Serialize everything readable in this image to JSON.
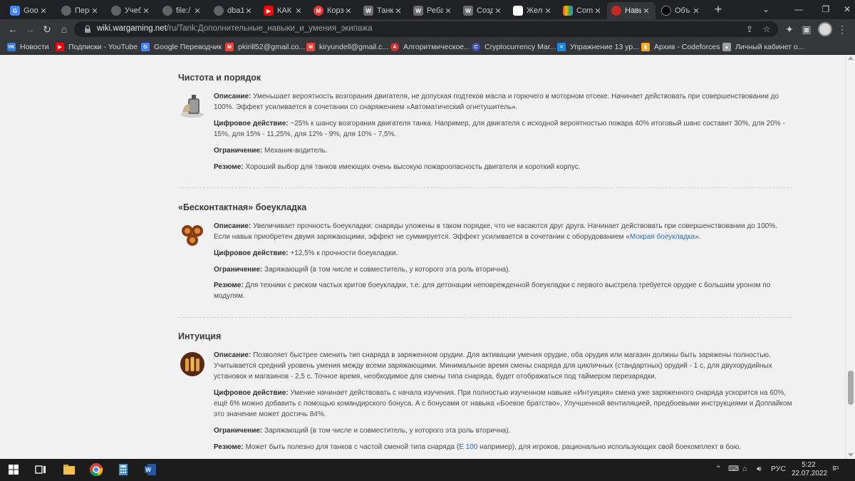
{
  "browser": {
    "tabs": [
      {
        "title": "Goog",
        "fav_color": "#4285f4",
        "fav_text": "G"
      },
      {
        "title": "Пере",
        "fav_color": "#5f6368",
        "fav_text": ""
      },
      {
        "title": "Учеб",
        "fav_color": "#5f6368",
        "fav_text": ""
      },
      {
        "title": "file:/",
        "fav_color": "#5f6368",
        "fav_text": ""
      },
      {
        "title": "dba1",
        "fav_color": "#5f6368",
        "fav_text": ""
      },
      {
        "title": "КАК",
        "fav_color": "#ff0000",
        "fav_text": "▶"
      },
      {
        "title": "Корз",
        "fav_color": "#e53935",
        "fav_text": "M"
      },
      {
        "title": "Танк",
        "fav_color": "#6d6d6d",
        "fav_text": "W"
      },
      {
        "title": "Реба",
        "fav_color": "#6d6d6d",
        "fav_text": "W"
      },
      {
        "title": "Созд",
        "fav_color": "#6d6d6d",
        "fav_text": "W"
      },
      {
        "title": "Желе",
        "fav_color": "#ffffff",
        "fav_text": ""
      },
      {
        "title": "Com",
        "fav_color": "#34a853",
        "fav_text": ""
      },
      {
        "title": "Навы",
        "fav_color": "#c62828",
        "fav_text": ""
      },
      {
        "title": "Объ",
        "fav_color": "#000000",
        "fav_text": ""
      }
    ],
    "active_tab_index": 12,
    "new_tab_label": "+",
    "url_host": "wiki.wargaming.net",
    "url_path": "/ru/Tank:Дополнительные_навыки_и_умения_экипажа",
    "bookmarks": [
      {
        "label": "Новости",
        "fav_color": "#2c7be5",
        "fav_text": "VK"
      },
      {
        "label": "Подписки - YouTube",
        "fav_color": "#ff0000",
        "fav_text": "▶"
      },
      {
        "label": "Google Переводчик",
        "fav_color": "#4285f4",
        "fav_text": "G"
      },
      {
        "label": "pkirill52@gmail.co...",
        "fav_color": "#ea4335",
        "fav_text": "M"
      },
      {
        "label": "kiryundell@gmail.c...",
        "fav_color": "#ea4335",
        "fav_text": "M"
      },
      {
        "label": "Алгоритмическое...",
        "fav_color": "#d32f2f",
        "fav_text": "A"
      },
      {
        "label": "Cryptocurrency Mar...",
        "fav_color": "#3f51b5",
        "fav_text": "C"
      },
      {
        "label": "Упражнение 13 ур...",
        "fav_color": "#1e88e5",
        "fav_text": "="
      },
      {
        "label": "Архив - Codeforces",
        "fav_color": "#f9a825",
        "fav_text": "▮"
      },
      {
        "label": "Личный кабинет о...",
        "fav_color": "#9e9e9e",
        "fav_text": "▲"
      }
    ]
  },
  "sections": [
    {
      "title": "Чистота и порядок",
      "desc_label": "Описание:",
      "desc": "Уменьшает вероятность возгорания двигателя, не допуская подтеков масла и горючего в моторном отсеке. Начинает действовать при совершенствовании до 100%. Эффект усиливается в сочетании со снаряжением «Автоматический огнетушитель».",
      "effect_label": "Цифровое действие:",
      "effect": "−25% к шансу возгорания двигателя танка. Например, для двигателя с исходной вероятностью пожара 40% итоговый шанс составит 30%, для 20% - 15%, для 15% - 11,25%, для 12% - 9%, для 10% - 7,5%.",
      "limit_label": "Ограничение:",
      "limit": "Механик-водитель.",
      "summary_label": "Резюме:",
      "summary": "Хороший выбор для танков имеющих очень высокую пожароопасность двигателя и короткий корпус."
    },
    {
      "title": "«Бесконтактная» боеукладка",
      "desc_label": "Описание:",
      "desc": "Увеличивает прочность боеукладки: снаряды уложены в таком порядке, что не касаются друг друга. Начинает действовать при совершенствовании до 100%. Если навык приобретен двумя заряжающими, эффект не суммируется. Эффект усиливается в сочетании с оборудованием «",
      "desc_link": "Мокрая боеукладка",
      "desc_tail": "».",
      "effect_label": "Цифровое действие:",
      "effect": "+12,5% к прочности боеукладки.",
      "limit_label": "Ограничение:",
      "limit": "Заряжающий (в том числе и совместитель, у которого эта роль вторична).",
      "summary_label": "Резюме:",
      "summary": "Для техники с риском частых критов боеукладки, т.е. для детонации неповрежденной боеукладки с первого выстрела требуется орудие с большим уроном по модулям."
    },
    {
      "title": "Интуиция",
      "desc_label": "Описание:",
      "desc": "Позволяет быстрее сменить тип снаряда в заряженном орудии. Для активации умения орудие, оба орудия или магазин должны быть заряжены полностью. Учитывается средний уровень умения между всеми заряжающими. Минимальное время смены снаряда для цикличных (стандартных) орудий - 1 с, для двухорудийных установок и магазинов - 2,5 с. Точное время, необходимое для смены типа снаряда, будет отображаться под таймером перезарядки.",
      "effect_label": "Цифровое действие:",
      "effect": "Умение начинает действовать с начала изучения. При полностью изученном навыке «Интуиция» смена уже заряженного снаряда ускорится на 60%, ещё 6% можно добавить с помощью командирского бонуса. А с бонусами от навыка «Боевое братство», Улучшенной вентиляцией, предбоевыми инструкциями и Доппайком это значение может достичь 84%.",
      "limit_label": "Ограничение:",
      "limit": "Заряжающий (в том числе и совместитель, у которого эта роль вторична).",
      "summary_label": "Резюме:",
      "summary_pre": "Может быть полезно для танков с частой сменой типа снаряда (",
      "summary_link": "Е 100",
      "summary_post": " например), для игроков, рационально использующих свой боекомплект в бою."
    }
  ],
  "taskbar": {
    "lang": "РУС",
    "time": "5:22",
    "date": "22.07.2022",
    "notif_count": "2"
  }
}
